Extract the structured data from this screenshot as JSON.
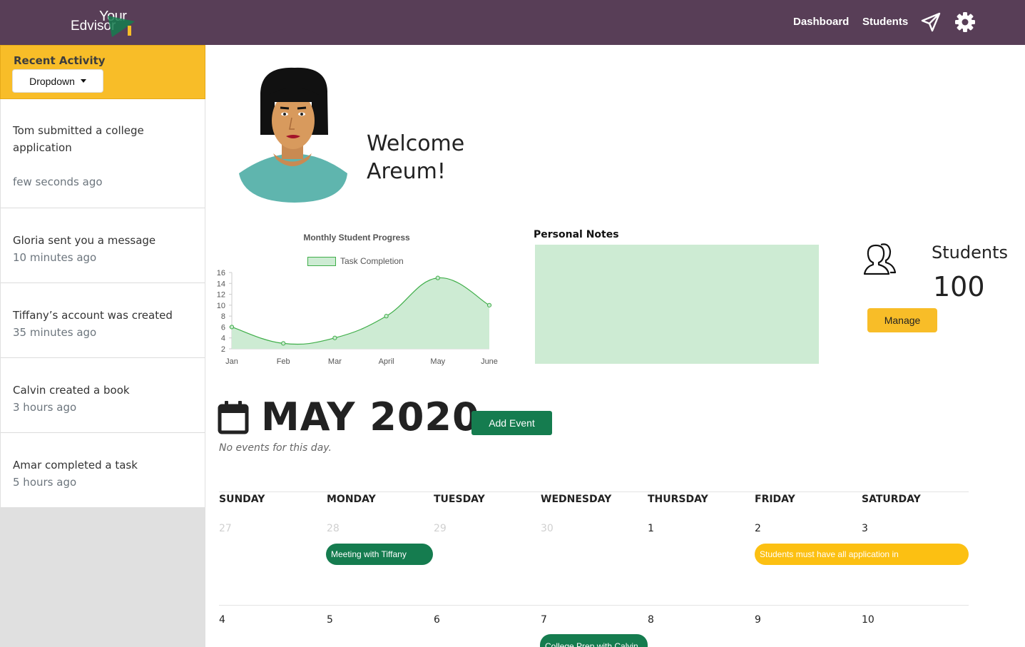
{
  "nav": {
    "logo_top": "Your",
    "logo_bottom": "Edvisor",
    "links": [
      "Dashboard",
      "Students"
    ],
    "icons": [
      "send-icon",
      "gear-icon"
    ]
  },
  "sidebar": {
    "title": "Recent Activity",
    "dropdown_label": "Dropdown",
    "items": [
      {
        "text": "Tom submitted a college application",
        "time": "few seconds ago"
      },
      {
        "text": "Gloria sent you a message",
        "time": "10 minutes ago"
      },
      {
        "text": "Tiffany’s account was created",
        "time": "35 minutes ago"
      },
      {
        "text": "Calvin created a book",
        "time": "3 hours ago"
      },
      {
        "text": "Amar completed a task",
        "time": "5 hours ago"
      }
    ]
  },
  "welcome": {
    "line1": "Welcome",
    "line2": "Areum!"
  },
  "chart_data": {
    "type": "area",
    "title": "Monthly Student Progress",
    "categories": [
      "Jan",
      "Feb",
      "Mar",
      "April",
      "May",
      "June"
    ],
    "series": [
      {
        "name": "Task Completion",
        "values": [
          6,
          3,
          4,
          8,
          15,
          10
        ]
      }
    ],
    "y_ticks": [
      2,
      4,
      6,
      8,
      10,
      12,
      14,
      16
    ],
    "ylim": [
      2,
      16
    ],
    "colors": {
      "fill": "#cdebd3",
      "line": "#3fae49"
    }
  },
  "notes": {
    "title": "Personal Notes"
  },
  "students": {
    "label": "Students",
    "count": "100",
    "button": "Manage"
  },
  "calendar": {
    "title": "MAY 2020",
    "add_button": "Add Event",
    "no_events": "No events for this day.",
    "days_of_week": [
      "SUNDAY",
      "MONDAY",
      "TUESDAY",
      "WEDNESDAY",
      "THURSDAY",
      "FRIDAY",
      "SATURDAY"
    ],
    "week1": [
      "27",
      "28",
      "29",
      "30",
      "1",
      "2",
      "3"
    ],
    "week2": [
      "4",
      "5",
      "6",
      "7",
      "8",
      "9",
      "10"
    ],
    "events": [
      {
        "title": "Meeting with Tiffany",
        "color": "#157c4f"
      },
      {
        "title": "Students must have all application in",
        "color": "#fcc012"
      },
      {
        "title": "College Prep with Calvin",
        "color": "#157c4f"
      }
    ]
  },
  "colors": {
    "nav": "#583e57",
    "accent": "#f8bd28",
    "green": "#157c4f"
  }
}
